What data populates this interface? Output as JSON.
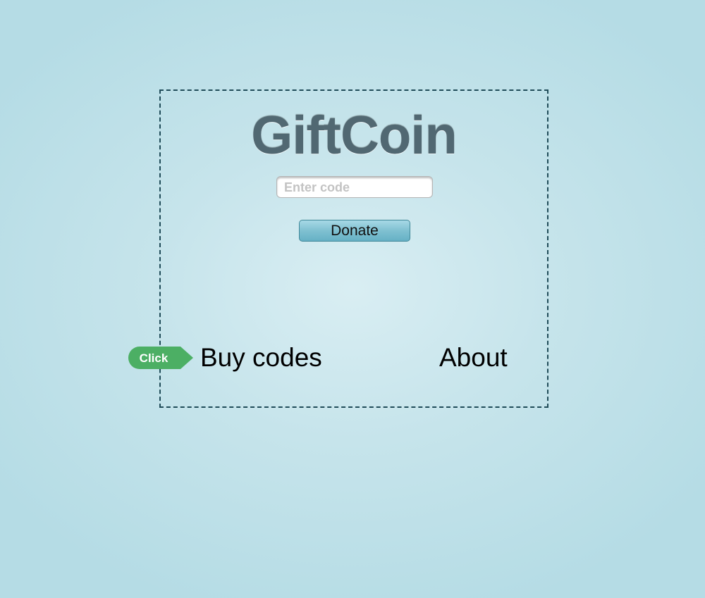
{
  "app": {
    "logo_text": "GiftCoin"
  },
  "form": {
    "code_placeholder": "Enter code",
    "code_value": "",
    "donate_label": "Donate"
  },
  "nav": {
    "buy_codes_label": "Buy codes",
    "about_label": "About"
  },
  "hint": {
    "click_label": "Click",
    "color": "#4caf64"
  },
  "colors": {
    "panel_border": "#1f4b58",
    "button": "#7fc0d1",
    "background": "#b5dce5"
  }
}
